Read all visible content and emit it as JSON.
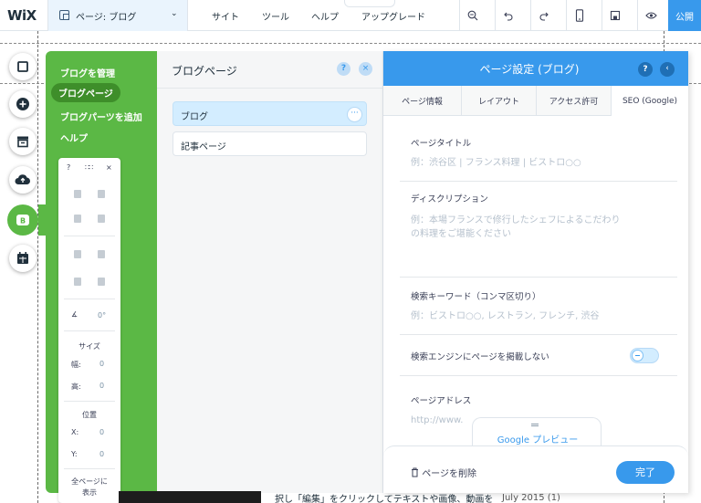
{
  "topbar": {
    "logo": "WiX",
    "page_selector": "ページ: ブログ",
    "menu": [
      "サイト",
      "ツール",
      "ヘルプ",
      "アップグレード"
    ],
    "collapse_glyph": "˄",
    "tools": [
      "zoom-out-icon",
      "undo-icon",
      "redo-icon",
      "mobile-icon",
      "save-icon",
      "preview-icon"
    ],
    "publish": "公開"
  },
  "left_bar": {
    "buttons": [
      "background-icon",
      "add-icon",
      "store-icon",
      "upload-icon",
      "blog-icon",
      "bookings-icon"
    ],
    "active_letter": "B"
  },
  "blog_manager": {
    "items": [
      "ブログを管理",
      "ブログページ",
      "ブログパーツを追加",
      "ヘルプ"
    ],
    "selected_index": 1
  },
  "palette": {
    "help": "?",
    "close": "×",
    "angle_value": "0°",
    "size_label": "サイズ",
    "width_label": "幅:",
    "width_value": "0",
    "height_label": "高:",
    "height_value": "0",
    "position_label": "位置",
    "x_label": "X:",
    "x_value": "0",
    "y_label": "Y:",
    "y_value": "0",
    "show_all_pages": "全ページに",
    "show_all_pages_2": "表示"
  },
  "pages_panel": {
    "title": "ブログページ",
    "help": "?",
    "close": "×",
    "pages": [
      {
        "label": "ブログ",
        "selected": true,
        "more": "···"
      },
      {
        "label": "記事ページ",
        "selected": false
      }
    ]
  },
  "settings": {
    "title": "ページ設定 (ブログ)",
    "help": "?",
    "back": "‹",
    "tabs": [
      "ページ情報",
      "レイアウト",
      "アクセス許可",
      "SEO (Google)"
    ],
    "selected_tab": 3,
    "page_title_label": "ページタイトル",
    "page_title_placeholder": "例：渋谷区 | フランス料理 | ビストロ○○",
    "description_label": "ディスクリプション",
    "description_placeholder_1": "例：本場フランスで修行したシェフによるこだわり",
    "description_placeholder_2": "の料理をご堪能ください",
    "keywords_label": "検索キーワード（コンマ区切り）",
    "keywords_placeholder": "例：ビストロ○○, レストラン, フレンチ, 渋谷",
    "hide_from_search_label": "検索エンジンにページを掲載しない",
    "hide_from_search": false,
    "address_label": "ページアドレス",
    "address_value": "http://www.",
    "google_preview": "Google プレビュー",
    "delete_page": "ページを削除",
    "done": "完了"
  },
  "canvas": {
    "text": "択し「編集」をクリックしてテキストや画像、動画を",
    "date": "July 2015 (1)"
  },
  "colors": {
    "accent": "#3899ec",
    "blog_green": "#5bb845",
    "blog_green_dark": "#3e8e2a"
  }
}
